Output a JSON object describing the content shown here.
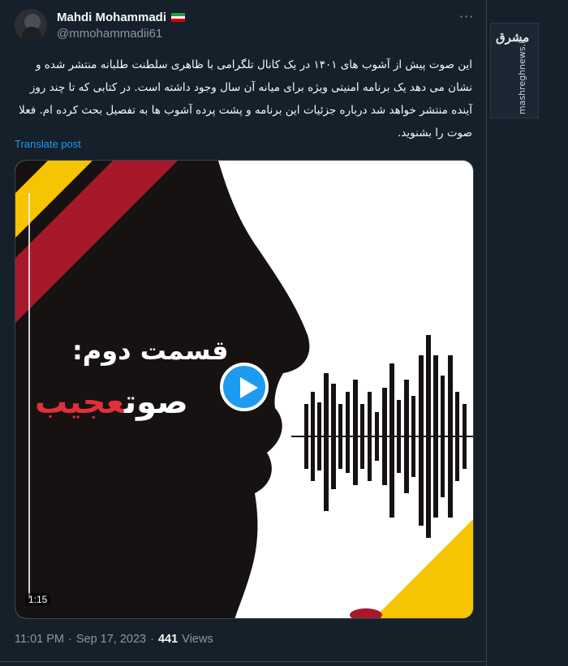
{
  "author": {
    "name": "Mahdi Mohammadi",
    "handle": "@mmohammadii61",
    "flag_icon": "iran-flag-icon"
  },
  "more_icon": "···",
  "tweet_text": "این صوت پیش از آشوب های ۱۴۰۱ در یک کانال تلگرامی با ظاهری سلطنت طلبانه منتشر شده و نشان می دهد یک برنامه امنیتی ویژه برای میانه آن سال وجود داشته است. در کتابی که تا چند روز آینده منتشر خواهد شد درباره جزئیات این برنامه و پشت پرده آشوب ها به تفصیل بحث کرده ام. فعلا صوت را بشنوید.",
  "translate_label": "Translate post",
  "media": {
    "title_line1": "قسمت دوم:",
    "title_white": "صوت",
    "title_red": "عجیب",
    "duration": "1:15",
    "colors": {
      "yellow": "#f6c400",
      "red": "#a8182b",
      "black": "#161212",
      "white": "#ffffff"
    }
  },
  "meta": {
    "time": "11:01 PM",
    "sep": "·",
    "date": "Sep 17, 2023",
    "sep2": "·",
    "views_count": "441",
    "views_label": "Views"
  },
  "watermark": {
    "logo": "مشرق",
    "url": "mashreghnews.ir"
  }
}
